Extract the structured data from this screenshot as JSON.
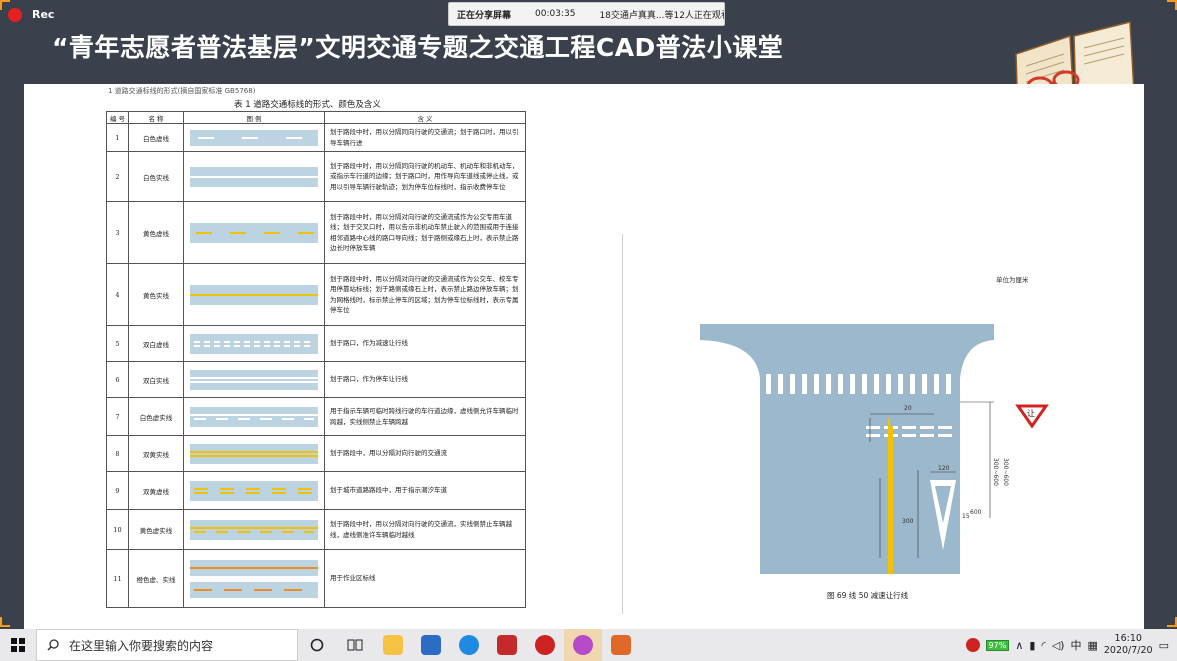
{
  "recording": {
    "label": "Rec"
  },
  "share_bar": {
    "status": "正在分享屏幕",
    "time": "00:03:35",
    "viewers": "18交通卢真真...等12人正在观看"
  },
  "slide": {
    "title": "“青年志愿者普法基层”文明交通专题之交通工程CAD普法小课堂"
  },
  "document": {
    "left_caption": "1 道路交通标线的形式(摘自国家标准 GB5768)",
    "table_title": "表 1 道路交通标线的形式、颜色及含义",
    "headers": [
      "编 号",
      "名 称",
      "图 例",
      "含 义"
    ],
    "rows": [
      {
        "no": "1",
        "name": "白色虚线",
        "meaning": "划于路段中时，用以分隔同向行驶的交通流；划于路口时，用以引导车辆行进"
      },
      {
        "no": "2",
        "name": "白色实线",
        "meaning": "划于路段中时，用以分隔同向行驶的机动车、机动车和非机动车，或指示车行道的边缘；划于路口时，用作导向车道线或停止线，或用以引导车辆行驶轨迹；划为停车位标线时，指示收费停车位"
      },
      {
        "no": "3",
        "name": "黄色虚线",
        "meaning": "划于路段中时，用以分隔对向行驶的交通流或作为公交专用车道线；划于交叉口时，用以告示非机动车禁止驶入的范围或用于连接相邻道路中心线的路口导向线；划于路侧或缘石上时，表示禁止路边长时停放车辆"
      },
      {
        "no": "4",
        "name": "黄色实线",
        "meaning": "划于路段中时，用以分隔对向行驶的交通流或作为公交车、校车专用停靠站标线；划于路侧或缘石上时，表示禁止路边停放车辆；划为网格线时，标示禁止停车的区域；划为停车位标线时，表示专属停车位"
      },
      {
        "no": "5",
        "name": "双白虚线",
        "meaning": "划于路口，作为减速让行线"
      },
      {
        "no": "6",
        "name": "双白实线",
        "meaning": "划于路口，作为停车让行线"
      },
      {
        "no": "7",
        "name": "白色虚实线",
        "meaning": "用于指示车辆可临时跨线行驶的车行道边缘，虚线侧允许车辆临时跨越，实线侧禁止车辆跨越"
      },
      {
        "no": "8",
        "name": "双黄实线",
        "meaning": "划于路段中，用以分隔对向行驶的交通流"
      },
      {
        "no": "9",
        "name": "双黄虚线",
        "meaning": "划于城市道路路段中，用于指示潮汐车道"
      },
      {
        "no": "10",
        "name": "黄色虚实线",
        "meaning": "划于路段中时，用以分隔对向行驶的交通流，实线侧禁止车辆越线，虚线侧准许车辆临时越线"
      },
      {
        "no": "11",
        "name": "橙色虚、实线",
        "meaning": "用于作业区标线"
      }
    ],
    "unit_label": "单位为厘米",
    "figure_caption": "图 69  线 50  减速让行线",
    "figure_labels": {
      "yield_sign": "让",
      "d20": "20",
      "d120": "120",
      "d300": "300",
      "d600": "600",
      "d15": "15",
      "d20b": "20",
      "dims_right": "300~600",
      "dims_right2": "300~600",
      "angle": "15"
    }
  },
  "taskbar": {
    "search_placeholder": "在这里输入你要搜索的内容",
    "battery": "97%",
    "ime": "中",
    "time": "16:10",
    "date": "2020/7/20"
  },
  "colors": {
    "accent_orange": "#ff9a1a",
    "rec_red": "#e62020",
    "road": "#9cb8cc",
    "yellow_line": "#f2c200"
  }
}
